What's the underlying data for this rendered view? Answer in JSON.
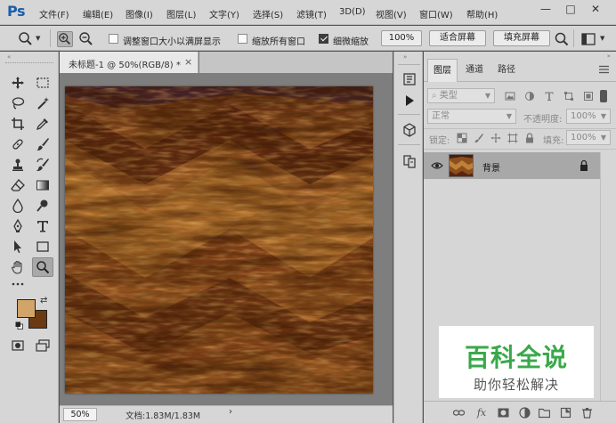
{
  "app": {
    "logo": "Ps",
    "menu": [
      "文件(F)",
      "编辑(E)",
      "图像(I)",
      "图层(L)",
      "文字(Y)",
      "选择(S)",
      "滤镜(T)",
      "3D(D)",
      "视图(V)",
      "窗口(W)",
      "帮助(H)"
    ],
    "window_controls": [
      "—",
      "□",
      "✕"
    ]
  },
  "options_bar": {
    "resize_windows_label": "调整窗口大小以满屏显示",
    "resize_windows_checked": false,
    "zoom_all_label": "缩放所有窗口",
    "zoom_all_checked": false,
    "scrubby_zoom_label": "细微缩放",
    "scrubby_zoom_checked": true,
    "zoom_value": "100%",
    "fit_screen_label": "适合屏幕",
    "fill_screen_label": "填充屏幕"
  },
  "document": {
    "tab_title": "未标题-1 @ 50%(RGB/8) *",
    "tab_close": "×",
    "zoom": "50%",
    "doc_info": "文档:1.83M/1.83M",
    "status_arrow": "›"
  },
  "colors": {
    "foreground": "#d1a469",
    "background": "#6b3a12",
    "accent": "#1b5ea8",
    "watermark_green": "#3aa84a"
  },
  "layers_panel": {
    "tabs": [
      "图层",
      "通道",
      "路径"
    ],
    "active_tab": "图层",
    "kind_filter": "类型",
    "blend_mode": "正常",
    "opacity_label": "不透明度:",
    "opacity_value": "100%",
    "lock_label": "锁定:",
    "fill_label": "填充:",
    "fill_value": "100%",
    "layers": [
      {
        "name": "背景",
        "visible": true,
        "locked": true
      }
    ]
  },
  "watermark": {
    "title": "百科全说",
    "subtitle": "助你轻松解决"
  }
}
